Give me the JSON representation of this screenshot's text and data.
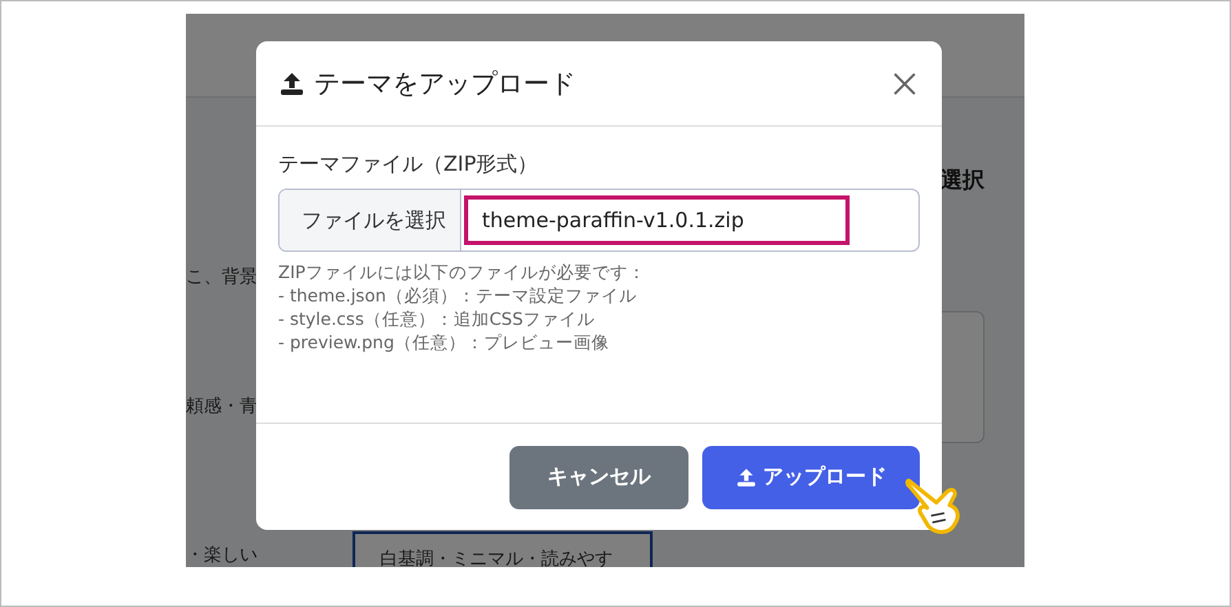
{
  "background": {
    "heading": "選択",
    "texts": [
      "こ、背景",
      "頼感・青",
      "・楽しい"
    ],
    "card": {
      "text": "白基調・ミニマル・読みやす",
      "selected": true
    }
  },
  "dialog": {
    "title": "テーマをアップロード",
    "field_label": "テーマファイル（ZIP形式）",
    "file_button": "ファイルを選択",
    "file_name": "theme-paraffin-v1.0.1.zip",
    "highlighted": true,
    "help": [
      "ZIPファイルには以下のファイルが必要です：",
      "- theme.json（必須）：テーマ設定ファイル",
      "- style.css（任意）：追加CSSファイル",
      "- preview.png（任意）：プレビュー画像"
    ],
    "buttons": [
      {
        "label": "キャンセル",
        "kind": "secondary"
      },
      {
        "label": "アップロード",
        "kind": "primary"
      }
    ]
  }
}
